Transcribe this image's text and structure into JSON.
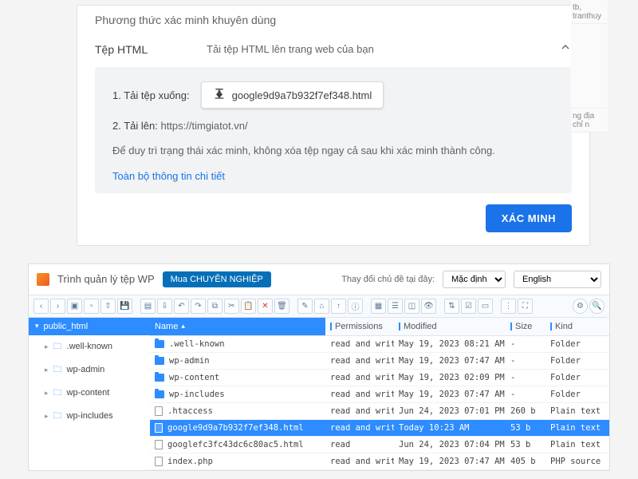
{
  "gsc": {
    "heading": "Phương thức xác minh khuyên dùng",
    "method_title": "Tệp HTML",
    "method_sub": "Tải tệp HTML lên trang web của bạn",
    "step1_label": "1. Tải tệp xuống:",
    "download_file": "google9d9a7b932f7ef348.html",
    "step2_prefix": "2. Tải lên: ",
    "step2_url": "https://timgiatot.vn/",
    "note": "Để duy trì trạng thái xác minh, không xóa tệp ngay cả sau khi xác minh thành công.",
    "more": "Toàn bộ thông tin chi tiết",
    "verify": "XÁC MINH",
    "side": {
      "truncated_1": "tb, tranthuy",
      "truncated_2": "ng địa chỉ n"
    }
  },
  "fm": {
    "title": "Trình quản lý tệp WP",
    "buy": "Mua CHUYÊN NGHIỆP",
    "owner_label": "Thay đổi chủ đề tại đây:",
    "theme_value": "Mặc định",
    "lang_value": "English",
    "tree": {
      "root": "public_html",
      "children": [
        ".well-known",
        "wp-admin",
        "wp-content",
        "wp-includes"
      ]
    },
    "columns": {
      "name": "Name",
      "perm": "Permissions",
      "mod": "Modified",
      "size": "Size",
      "kind": "Kind"
    },
    "rows": [
      {
        "name": ".well-known",
        "type": "folder",
        "perm": "read and write",
        "mod": "May 19, 2023 08:21 AM",
        "size": "-",
        "kind": "Folder",
        "selected": false
      },
      {
        "name": "wp-admin",
        "type": "folder",
        "perm": "read and write",
        "mod": "May 19, 2023 07:47 AM",
        "size": "-",
        "kind": "Folder",
        "selected": false
      },
      {
        "name": "wp-content",
        "type": "folder",
        "perm": "read and write",
        "mod": "May 19, 2023 02:09 PM",
        "size": "-",
        "kind": "Folder",
        "selected": false
      },
      {
        "name": "wp-includes",
        "type": "folder",
        "perm": "read and write",
        "mod": "May 19, 2023 07:47 AM",
        "size": "-",
        "kind": "Folder",
        "selected": false
      },
      {
        "name": ".htaccess",
        "type": "file",
        "perm": "read and write",
        "mod": "Jun 24, 2023 07:01 PM",
        "size": "260 b",
        "kind": "Plain text",
        "selected": false
      },
      {
        "name": "google9d9a7b932f7ef348.html",
        "type": "file",
        "perm": "read and write",
        "mod": "Today 10:23 AM",
        "size": "53 b",
        "kind": "Plain text",
        "selected": true
      },
      {
        "name": "googlefc3fc43dc6c80ac5.html",
        "type": "file",
        "perm": "read",
        "mod": "Jun 24, 2023 07:04 PM",
        "size": "53 b",
        "kind": "Plain text",
        "selected": false
      },
      {
        "name": "index.php",
        "type": "file",
        "perm": "read and write",
        "mod": "May 19, 2023 07:47 AM",
        "size": "405 b",
        "kind": "PHP source",
        "selected": false
      }
    ]
  }
}
